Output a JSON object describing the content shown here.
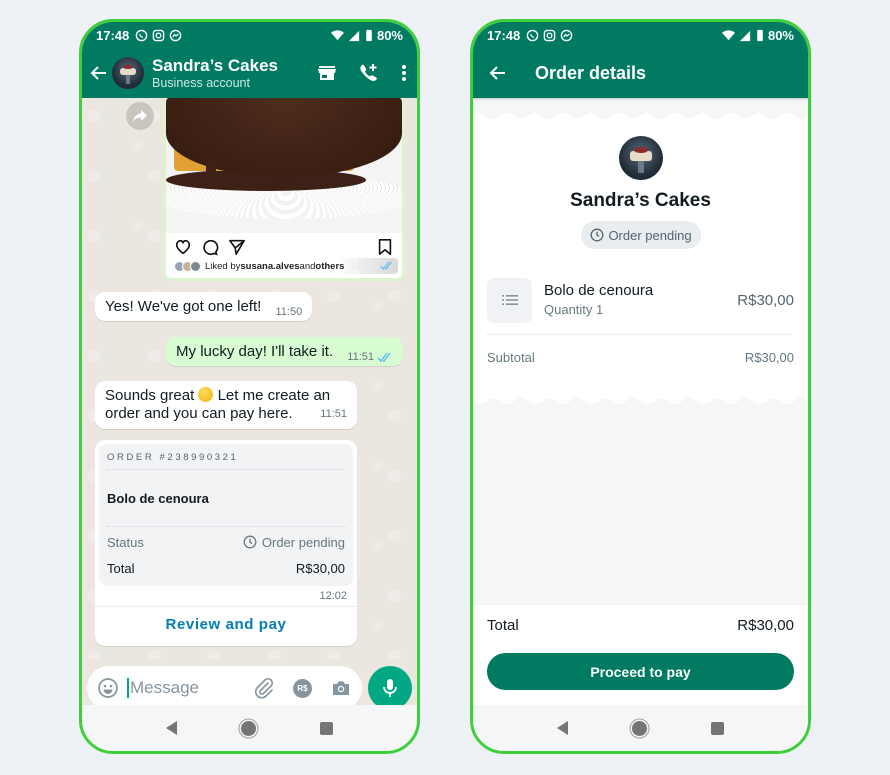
{
  "status_bar": {
    "time": "17:48",
    "battery": "80%",
    "notification_icons": [
      "whatsapp-icon",
      "instagram-icon",
      "messenger-icon"
    ],
    "system_icons": [
      "wifi-icon",
      "signal-icon",
      "battery-icon"
    ]
  },
  "chat": {
    "header": {
      "name": "Sandra’s Cakes",
      "subtitle": "Business account",
      "actions": [
        "storefront-icon",
        "add-call-icon",
        "more-vert-icon"
      ]
    },
    "instagram_post": {
      "liked_prefix": "Liked by ",
      "liked_user": "susana.alves",
      "liked_middle": " and ",
      "liked_suffix": "others",
      "time": "11:46"
    },
    "messages": [
      {
        "direction": "in",
        "text": "Yes! We've got one left!",
        "time": "11:50"
      },
      {
        "direction": "out",
        "text": "My lucky day! I'll take it.",
        "time": "11:51",
        "status": "read"
      },
      {
        "direction": "in",
        "text_before_emoji": "Sounds great ",
        "text_after_emoji": " Let me create an order and you can pay here.",
        "time": "11:51"
      }
    ],
    "order_message": {
      "order_number": "ORDER #238990321",
      "item": "Bolo de cenoura",
      "status_label": "Status",
      "status_value": "Order pending",
      "total_label": "Total",
      "total_value": "R$30,00",
      "time": "12:02",
      "cta": "Review and pay"
    },
    "composer": {
      "placeholder": "Message",
      "payment_badge": "R$"
    }
  },
  "order_details": {
    "title": "Order details",
    "business_name": "Sandra’s Cakes",
    "status": "Order pending",
    "items": [
      {
        "name": "Bolo de cenoura",
        "quantity": "Quantity 1",
        "price": "R$30,00"
      }
    ],
    "subtotal_label": "Subtotal",
    "subtotal_value": "R$30,00",
    "total_label": "Total",
    "total_value": "R$30,00",
    "cta": "Proceed to pay"
  },
  "colors": {
    "whatsapp_green": "#017a62",
    "accent_green": "#00a884",
    "phone_frame": "#3ecf3a",
    "link_blue": "#027eb5",
    "outgoing_bubble": "#d9fdd3"
  }
}
